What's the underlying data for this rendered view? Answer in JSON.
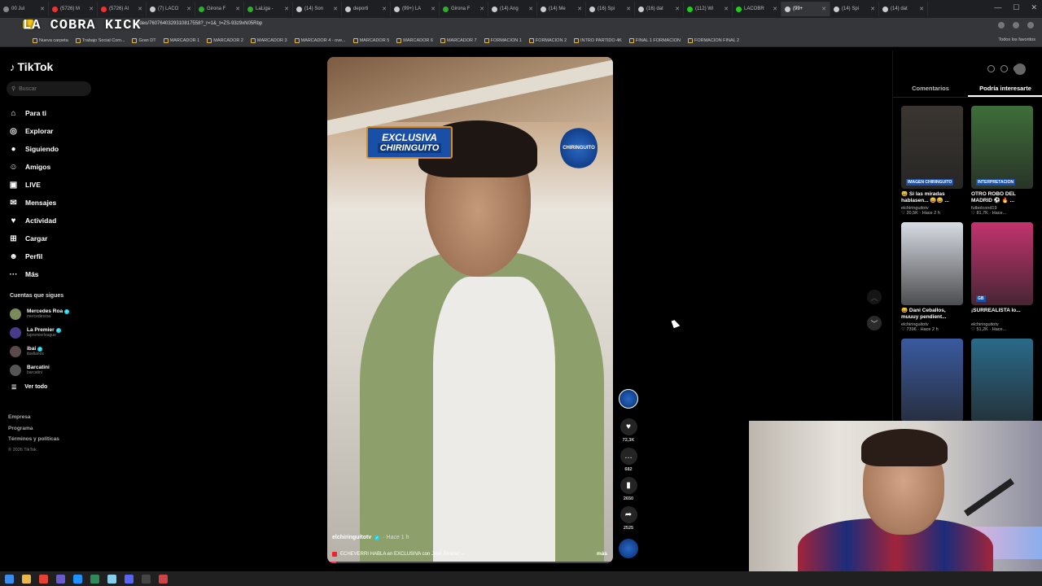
{
  "browser": {
    "tabs": [
      {
        "label": "00 Jul",
        "color": "#888"
      },
      {
        "label": "(5726) M",
        "color": "#e33"
      },
      {
        "label": "(5726) Al",
        "color": "#e33"
      },
      {
        "label": "(7) LACO",
        "color": "#ccc"
      },
      {
        "label": "Girona F",
        "color": "#3a3"
      },
      {
        "label": "LaLiga -",
        "color": "#3a3"
      },
      {
        "label": "(14) Son",
        "color": "#ccc"
      },
      {
        "label": "deporti",
        "color": "#ccc"
      },
      {
        "label": "(99+) LA",
        "color": "#ccc"
      },
      {
        "label": "Girona F",
        "color": "#3a3"
      },
      {
        "label": "(14) Ang",
        "color": "#ccc"
      },
      {
        "label": "(14) Me",
        "color": "#ccc"
      },
      {
        "label": "(16) Spi",
        "color": "#ccc"
      },
      {
        "label": "(16) dat",
        "color": "#ccc"
      },
      {
        "label": "(112) Wi",
        "color": "#2c2"
      },
      {
        "label": "LACOBR",
        "color": "#2c2"
      },
      {
        "label": "(99+",
        "color": "#ccc",
        "active": true
      },
      {
        "label": "(14) Spi",
        "color": "#ccc"
      },
      {
        "label": "(14) dat",
        "color": "#ccc"
      }
    ],
    "url": "ideo/7607640329310817558?_r=1&_t=ZS-93z9xN05Rbp",
    "overlay_logo": "LA COBRA KICK",
    "bookmarks": [
      "Nueva carpeta",
      "Trabajo Social Com...",
      "Gran DT",
      "MARCADOR 1",
      "MARCADOR 2",
      "MARCADOR 3",
      "MARCADOR 4 - ove...",
      "MARCADOR 5",
      "MARCADOR 6",
      "MARCADOR 7",
      "FORMACION 1",
      "FORMACION 2",
      "INTRO PARTIDO 4K",
      "FINAL 1 FORMACION",
      "FORMACION FINAL 2"
    ],
    "bookmarks_right": "Todos los favoritos"
  },
  "sidebar": {
    "logo": "TikTok",
    "search_placeholder": "Buscar",
    "nav": [
      {
        "icon": "home-icon",
        "glyph": "⌂",
        "label": "Para ti"
      },
      {
        "icon": "compass-icon",
        "glyph": "◎",
        "label": "Explorar"
      },
      {
        "icon": "following-icon",
        "glyph": "●",
        "label": "Siguiendo"
      },
      {
        "icon": "friends-icon",
        "glyph": "☺",
        "label": "Amigos"
      },
      {
        "icon": "live-icon",
        "glyph": "▣",
        "label": "LIVE"
      },
      {
        "icon": "messages-icon",
        "glyph": "✉",
        "label": "Mensajes"
      },
      {
        "icon": "activity-icon",
        "glyph": "♥",
        "label": "Actividad"
      },
      {
        "icon": "upload-icon",
        "glyph": "⊞",
        "label": "Cargar"
      },
      {
        "icon": "profile-icon",
        "glyph": "☻",
        "label": "Perfil"
      },
      {
        "icon": "more-icon",
        "glyph": "···",
        "label": "Más"
      }
    ],
    "following_header": "Cuentas que sigues",
    "following": [
      {
        "name": "Mercedes Roa",
        "handle": "mercedesroa",
        "color": "#7a8a5a",
        "verified": true
      },
      {
        "name": "La Premier",
        "handle": "lapremierleague",
        "color": "#4a3a8a",
        "verified": true
      },
      {
        "name": "ibai",
        "handle": "ibaillanos",
        "color": "#5a4a4a",
        "verified": true
      },
      {
        "name": "Barcatini",
        "handle": "barcatini",
        "color": "#555",
        "verified": false
      }
    ],
    "see_all": "Ver todo",
    "footer": [
      "Empresa",
      "Programa",
      "Términos y políticas"
    ],
    "copyright": "© 2026 TikTok"
  },
  "video": {
    "badge_exclusive_line1": "EXCLUSIVA",
    "badge_exclusive_line2": "CHIRINGUITO",
    "badge_round": "CHIRINGUITO",
    "author": "elchiringuitotv",
    "posted": "· Hace 1 h",
    "description": "ECHEVERRI HABLA en EXCLUSIVA con José Álvarez:--",
    "more": "más",
    "progress": 0.03
  },
  "actions": {
    "likes": "72,3K",
    "comments": "682",
    "saves": "2650",
    "shares": "2525"
  },
  "right_panel": {
    "tabs": [
      "Comentarios",
      "Podría interesarte"
    ],
    "active_tab": 1,
    "cards": [
      {
        "title": "😄 Si las miradas hablasen... 😄😄 ...",
        "author": "elchiringuitotv",
        "likes": "20,5K",
        "ago": "Hace 2 h",
        "bg": "#3a3530",
        "label": "IMAGEN CHIRINGUITO"
      },
      {
        "title": "OTRO ROBO DEL MADRID ⚽ 🔥 ...",
        "author": "futbolcond19",
        "likes": "81,7K",
        "ago": "Hace...",
        "bg": "#3f6e3a",
        "label": "INTERPRETACION"
      },
      {
        "title": "😄 Dani Ceballos, muuuy pendient...",
        "author": "elchiringuitotv",
        "likes": "7396",
        "ago": "Hace 2 h",
        "bg": "#d8dce4",
        "label": ""
      },
      {
        "title": "¡SURREALISTA lo...",
        "author": "elchiringuitotv",
        "likes": "51,2K",
        "ago": "Hace...",
        "bg": "#c2336e",
        "label": "GB"
      },
      {
        "title": "",
        "author": "",
        "likes": "",
        "ago": "",
        "bg": "#3a5aa0",
        "label": ""
      },
      {
        "title": "",
        "author": "",
        "likes": "",
        "ago": "",
        "bg": "#2a6a8a",
        "label": ""
      }
    ]
  },
  "taskbar": {
    "icons": [
      {
        "name": "start-icon",
        "color": "#3b8df0"
      },
      {
        "name": "file-explorer-icon",
        "color": "#e8b84b"
      },
      {
        "name": "chrome-icon",
        "color": "#e34234"
      },
      {
        "name": "app-icon",
        "color": "#6a5acd"
      },
      {
        "name": "edge-icon",
        "color": "#1e90ff"
      },
      {
        "name": "app2-icon",
        "color": "#2e8b57"
      },
      {
        "name": "notepad-icon",
        "color": "#87ceeb"
      },
      {
        "name": "discord-icon",
        "color": "#5865f2"
      },
      {
        "name": "obs-icon",
        "color": "#444"
      },
      {
        "name": "app3-icon",
        "color": "#c44"
      }
    ]
  }
}
